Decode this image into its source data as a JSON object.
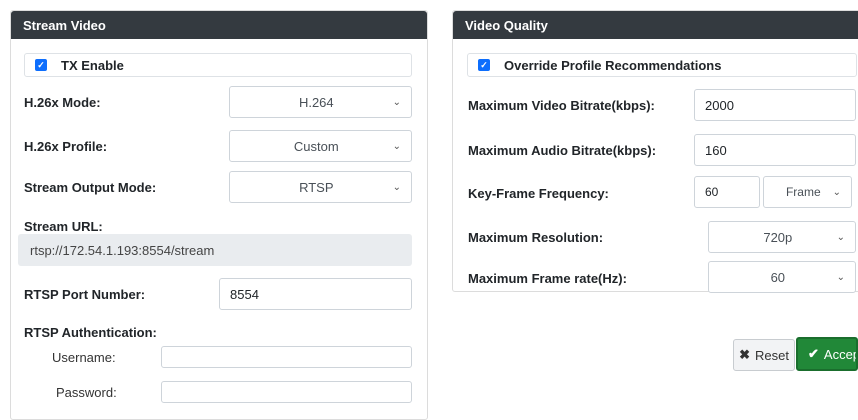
{
  "stream_video": {
    "header": "Stream Video",
    "tx_enable": {
      "label": "TX Enable",
      "checked": true
    },
    "h26x_mode": {
      "label": "H.26x Mode:",
      "value": "H.264"
    },
    "h26x_profile": {
      "label": "H.26x Profile:",
      "value": "Custom"
    },
    "stream_output_mode": {
      "label": "Stream Output Mode:",
      "value": "RTSP"
    },
    "stream_url": {
      "label": "Stream URL:",
      "value": "rtsp://172.54.1.193:8554/stream"
    },
    "rtsp_port": {
      "label": "RTSP Port Number:",
      "value": "8554"
    },
    "rtsp_auth": {
      "label": "RTSP Authentication:"
    },
    "username": {
      "label": "Username:",
      "value": ""
    },
    "password": {
      "label": "Password:",
      "value": ""
    }
  },
  "video_quality": {
    "header": "Video Quality",
    "override": {
      "label": "Override Profile Recommendations",
      "checked": true
    },
    "max_video_bitrate": {
      "label": "Maximum Video Bitrate(kbps):",
      "value": "2000"
    },
    "max_audio_bitrate": {
      "label": "Maximum Audio Bitrate(kbps):",
      "value": "160"
    },
    "key_frame": {
      "label": "Key-Frame Frequency:",
      "value": "60",
      "unit": "Frame"
    },
    "max_resolution": {
      "label": "Maximum Resolution:",
      "value": "720p"
    },
    "max_frame_rate": {
      "label": "Maximum Frame rate(Hz):",
      "value": "60"
    }
  },
  "actions": {
    "reset_label": "Reset",
    "accept_label": "Accept"
  },
  "icons": {
    "check": "✓",
    "chevron": "⌄",
    "reset": "✖",
    "accept": "✔"
  },
  "colors": {
    "header_bg": "#343a40",
    "checkbox": "#0d6efd",
    "accept": "#218838"
  }
}
